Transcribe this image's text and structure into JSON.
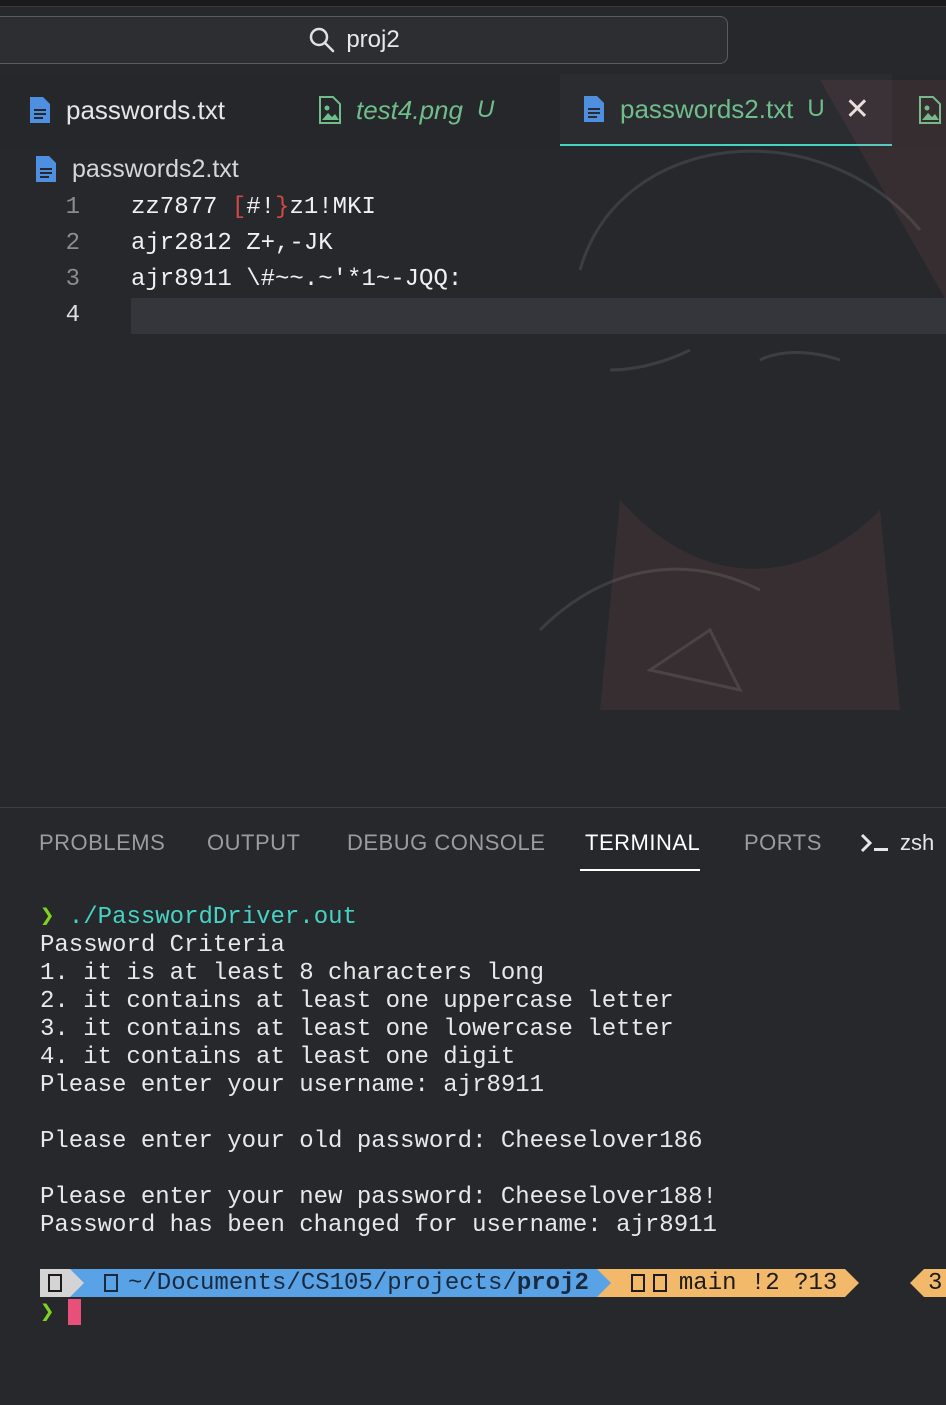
{
  "search": {
    "query": "proj2"
  },
  "tabs": [
    {
      "label": "passwords.txt",
      "type": "text",
      "modified": ""
    },
    {
      "label": "test4.png",
      "type": "image",
      "modified": "U"
    },
    {
      "label": "passwords2.txt",
      "type": "text",
      "modified": "U",
      "active": true
    }
  ],
  "breadcrumb": {
    "file": "passwords2.txt"
  },
  "editor": {
    "lines": [
      {
        "num": "1",
        "pre": "zz7877 ",
        "open": "[",
        "mid": "#!",
        "close": "}",
        "post": "z1!MKI"
      },
      {
        "num": "2",
        "text": "ajr2812 Z+,-JK"
      },
      {
        "num": "3",
        "text": "ajr8911 \\#~~.~'*1~-JQQ:"
      },
      {
        "num": "4",
        "text": ""
      }
    ],
    "bracket_color": "#d04848"
  },
  "panel": {
    "tabs": [
      "PROBLEMS",
      "OUTPUT",
      "DEBUG CONSOLE",
      "TERMINAL",
      "PORTS"
    ],
    "active_tab": "TERMINAL",
    "shell": "zsh"
  },
  "terminal": {
    "prompt_symbol": "❯",
    "command": "./PasswordDriver.out",
    "output": [
      "Password Criteria",
      "1. it is at least 8 characters long",
      "2. it contains at least one uppercase letter",
      "3. it contains at least one lowercase letter",
      "4. it contains at least one digit",
      "Please enter your username: ajr8911",
      "",
      "Please enter your old password: Cheeselover186",
      "",
      "Please enter your new password: Cheeselover188!",
      "Password has been changed for username: ajr8911"
    ],
    "prompt_path_prefix": "~/Documents/CS105/projects/",
    "prompt_path_last": "proj2",
    "git_branch": "main",
    "git_status": "!2 ?13",
    "right_segment": "3"
  },
  "colors": {
    "accent": "#46d2c4",
    "git_segment": "#f3b96a",
    "path_segment": "#5aa2e6",
    "cursor": "#e8507a"
  }
}
